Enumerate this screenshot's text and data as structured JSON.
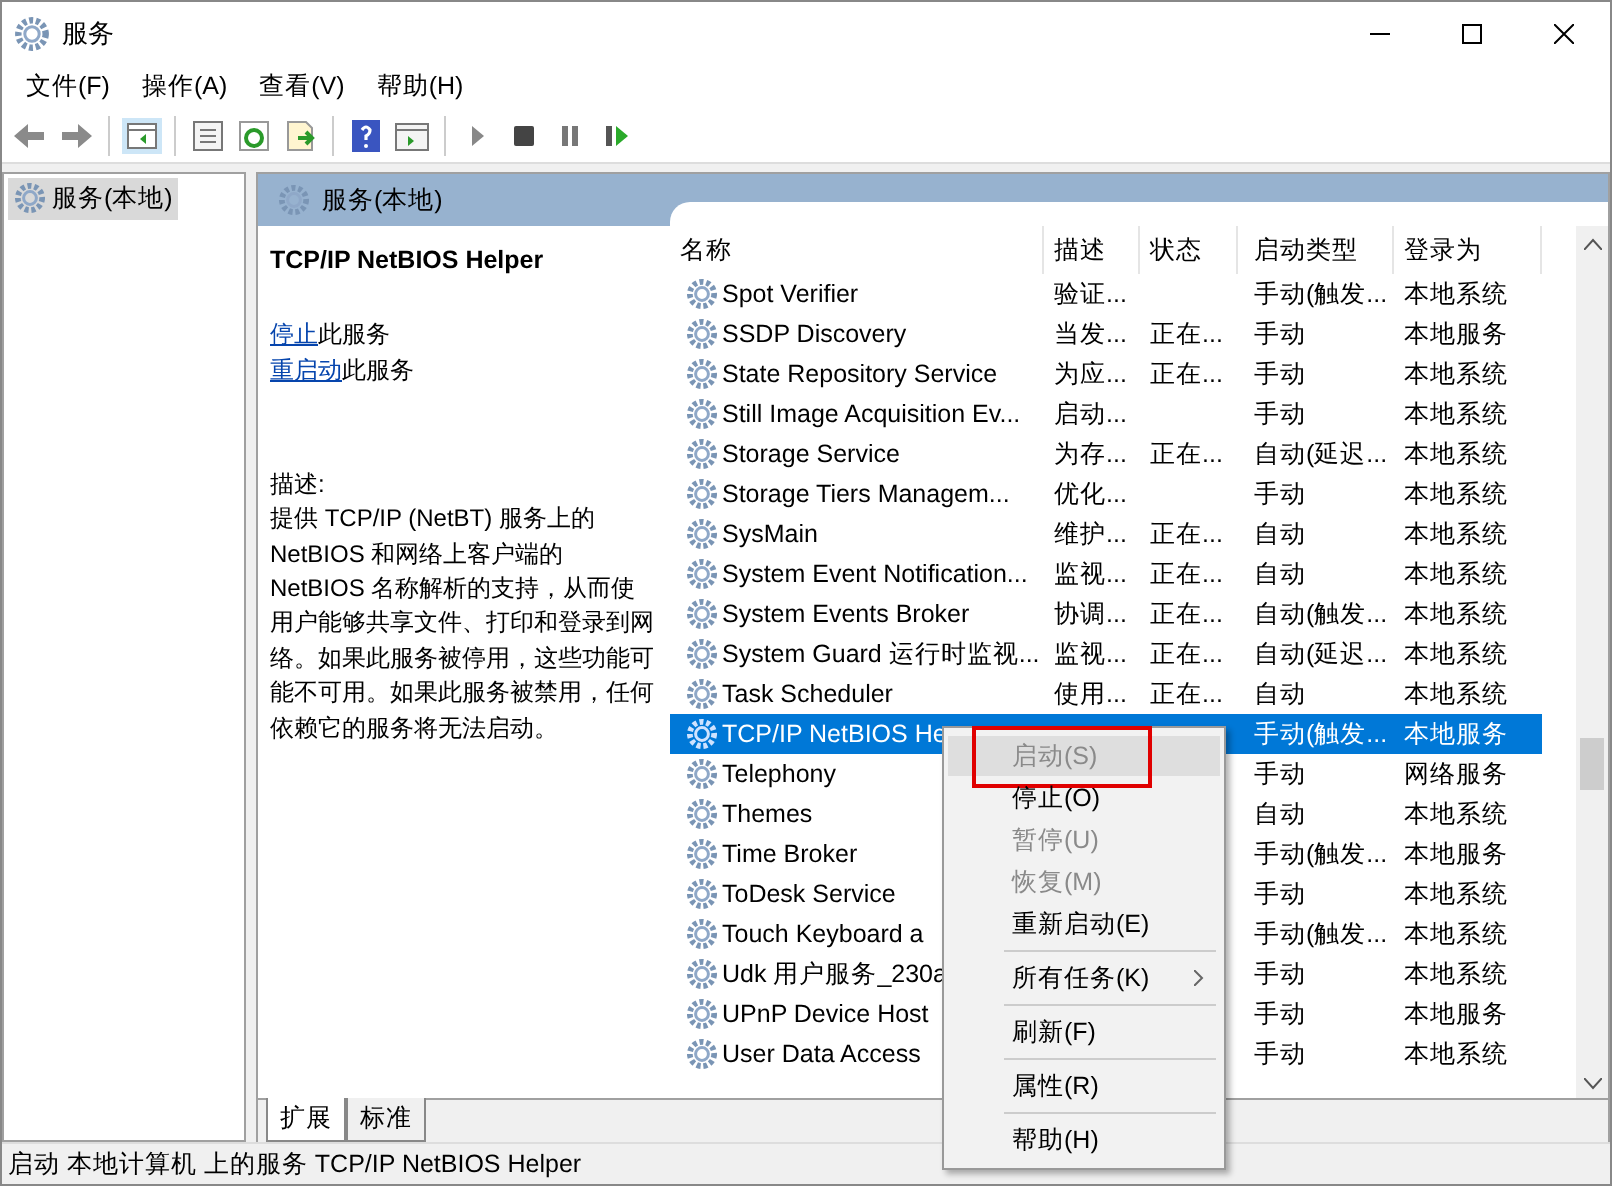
{
  "window": {
    "title": "服务"
  },
  "menu_bar": [
    "文件(F)",
    "操作(A)",
    "查看(V)",
    "帮助(H)"
  ],
  "tree": {
    "items": [
      {
        "label": "服务(本地)",
        "selected": true
      }
    ]
  },
  "panel_header": "服务(本地)",
  "detail": {
    "title": "TCP/IP NetBIOS Helper",
    "links": [
      {
        "link": "停止",
        "text": "此服务"
      },
      {
        "link": "重启动",
        "text": "此服务"
      }
    ],
    "description_label": "描述:",
    "description": "提供 TCP/IP (NetBT) 服务上的 NetBIOS 和网络上客户端的 NetBIOS 名称解析的支持，从而使用户能够共享文件、打印和登录到网络。如果此服务被停用，这些功能可能不可用。如果此服务被禁用，任何依赖它的服务将无法启动。"
  },
  "table": {
    "columns": [
      "名称",
      "描述",
      "状态",
      "启动类型",
      "登录为"
    ],
    "rows": [
      {
        "name": "Spot Verifier",
        "description": "验证...",
        "startup_type": "手动(触发...",
        "log_on_as": "本地系统",
        "selected": false
      },
      {
        "name": "SSDP Discovery",
        "description": "当发...",
        "status": "正在...",
        "startup_type": "手动",
        "log_on_as": "本地服务",
        "selected": false
      },
      {
        "name": "State Repository Service",
        "description": "为应...",
        "status": "正在...",
        "startup_type": "手动",
        "log_on_as": "本地系统",
        "selected": false
      },
      {
        "name": "Still Image Acquisition Ev...",
        "description": "启动...",
        "startup_type": "手动",
        "log_on_as": "本地系统",
        "selected": false
      },
      {
        "name": "Storage Service",
        "description": "为存...",
        "status": "正在...",
        "startup_type": "自动(延迟...",
        "log_on_as": "本地系统",
        "selected": false
      },
      {
        "name": "Storage Tiers Managem...",
        "description": "优化...",
        "startup_type": "手动",
        "log_on_as": "本地系统",
        "selected": false
      },
      {
        "name": "SysMain",
        "description": "维护...",
        "status": "正在...",
        "startup_type": "自动",
        "log_on_as": "本地系统",
        "selected": false
      },
      {
        "name": "System Event Notification...",
        "description": "监视...",
        "status": "正在...",
        "startup_type": "自动",
        "log_on_as": "本地系统",
        "selected": false
      },
      {
        "name": "System Events Broker",
        "description": "协调...",
        "status": "正在...",
        "startup_type": "自动(触发...",
        "log_on_as": "本地系统",
        "selected": false
      },
      {
        "name": "System Guard 运行时监视...",
        "description": "监视...",
        "status": "正在...",
        "startup_type": "自动(延迟...",
        "log_on_as": "本地系统",
        "selected": false
      },
      {
        "name": "Task Scheduler",
        "description": "使用...",
        "status": "正在...",
        "startup_type": "自动",
        "log_on_as": "本地系统",
        "selected": false
      },
      {
        "name": "TCP/IP NetBIOS He",
        "startup_type": "手动(触发...",
        "log_on_as": "本地服务",
        "selected": true
      },
      {
        "name": "Telephony",
        "startup_type": "手动",
        "log_on_as": "网络服务",
        "selected": false
      },
      {
        "name": "Themes",
        "startup_type": "自动",
        "log_on_as": "本地系统",
        "selected": false
      },
      {
        "name": "Time Broker",
        "startup_type": "手动(触发...",
        "log_on_as": "本地服务",
        "selected": false
      },
      {
        "name": "ToDesk Service",
        "startup_type": "手动",
        "log_on_as": "本地系统",
        "selected": false
      },
      {
        "name": "Touch Keyboard a",
        "startup_type": "手动(触发...",
        "log_on_as": "本地系统",
        "selected": false
      },
      {
        "name": "Udk 用户服务_230a",
        "startup_type": "手动",
        "log_on_as": "本地系统",
        "selected": false
      },
      {
        "name": "UPnP Device Host",
        "startup_type": "手动",
        "log_on_as": "本地服务",
        "selected": false
      },
      {
        "name": "User Data Access",
        "startup_type": "手动",
        "log_on_as": "本地系统",
        "selected": false
      }
    ]
  },
  "context_menu": [
    {
      "kind": "item",
      "label": "启动(S)",
      "disabled": true,
      "highlighted": true
    },
    {
      "kind": "item",
      "label": "停止(O)",
      "disabled": false,
      "highlighted": false
    },
    {
      "kind": "item",
      "label": "暂停(U)",
      "disabled": true,
      "highlighted": false
    },
    {
      "kind": "item",
      "label": "恢复(M)",
      "disabled": true,
      "highlighted": false
    },
    {
      "kind": "item",
      "label": "重新启动(E)",
      "disabled": false,
      "highlighted": false
    },
    {
      "kind": "separator"
    },
    {
      "kind": "submenu",
      "label": "所有任务(K)",
      "disabled": false,
      "highlighted": false
    },
    {
      "kind": "separator"
    },
    {
      "kind": "item",
      "label": "刷新(F)",
      "disabled": false,
      "highlighted": false
    },
    {
      "kind": "separator"
    },
    {
      "kind": "item",
      "label": "属性(R)",
      "disabled": false,
      "highlighted": false
    },
    {
      "kind": "separator"
    },
    {
      "kind": "item",
      "label": "帮助(H)",
      "disabled": false,
      "highlighted": false
    }
  ],
  "bottom_tabs": [
    {
      "label": "扩展",
      "selected": true
    },
    {
      "label": "标准",
      "selected": false
    }
  ],
  "status_bar": "启动 本地计算机 上的服务 TCP/IP NetBIOS Helper"
}
